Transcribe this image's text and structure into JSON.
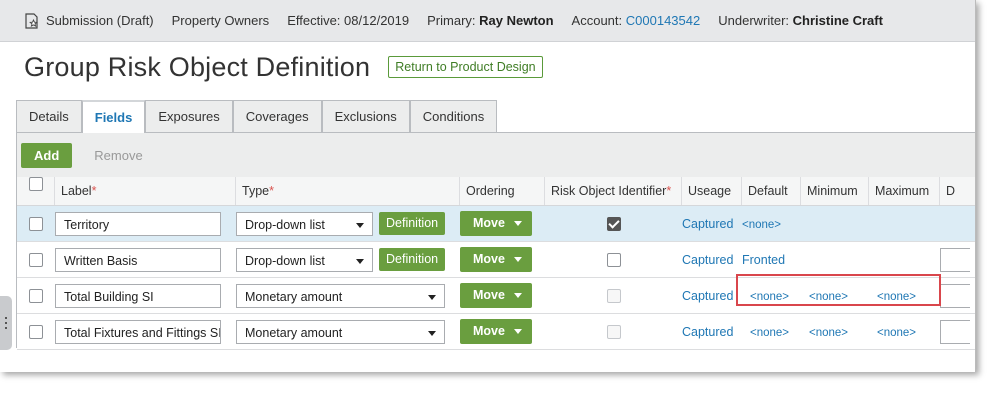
{
  "topbar": {
    "submission": "Submission (Draft)",
    "product": "Property Owners",
    "effective_label": "Effective:",
    "effective_date": "08/12/2019",
    "primary_label": "Primary:",
    "primary_name": "Ray Newton",
    "account_label": "Account:",
    "account_number": "C000143542",
    "underwriter_label": "Underwriter:",
    "underwriter_name": "Christine Craft"
  },
  "page": {
    "title": "Group Risk Object Definition",
    "return_button": "Return to Product Design"
  },
  "tabs": [
    {
      "label": "Details"
    },
    {
      "label": "Fields",
      "active": true
    },
    {
      "label": "Exposures"
    },
    {
      "label": "Coverages"
    },
    {
      "label": "Exclusions"
    },
    {
      "label": "Conditions"
    }
  ],
  "toolbar": {
    "add_label": "Add",
    "remove_label": "Remove"
  },
  "columns": {
    "label": "Label",
    "type": "Type",
    "ordering": "Ordering",
    "rio": "Risk Object Identifier",
    "useage": "Useage",
    "default": "Default",
    "minimum": "Minimum",
    "maximum": "Maximum",
    "more": "D",
    "required_mark": "*"
  },
  "rows": [
    {
      "label": "Territory",
      "type": "Drop-down list",
      "definition": "Definition",
      "move": "Move",
      "rio_checked": true,
      "useage": "Captured",
      "default": "<none>",
      "minimum": "",
      "maximum": ""
    },
    {
      "label": "Written Basis",
      "type": "Drop-down list",
      "definition": "Definition",
      "move": "Move",
      "rio_checked": false,
      "useage": "Captured",
      "default": "Fronted",
      "minimum": "",
      "maximum": ""
    },
    {
      "label": "Total Building SI",
      "type": "Monetary amount",
      "definition": "",
      "move": "Move",
      "rio_checked": false,
      "useage": "Captured",
      "default": "<none>",
      "minimum": "<none>",
      "maximum": "<none>"
    },
    {
      "label": "Total Fixtures and Fittings SI",
      "type": "Monetary amount",
      "definition": "",
      "move": "Move",
      "rio_checked": false,
      "useage": "Captured",
      "default": "<none>",
      "minimum": "<none>",
      "maximum": "<none>"
    }
  ],
  "colors": {
    "accent_green": "#6a9e3f",
    "link_blue": "#1f77b4",
    "highlight_red": "#d9464c",
    "selected_row": "#dcecf5"
  }
}
